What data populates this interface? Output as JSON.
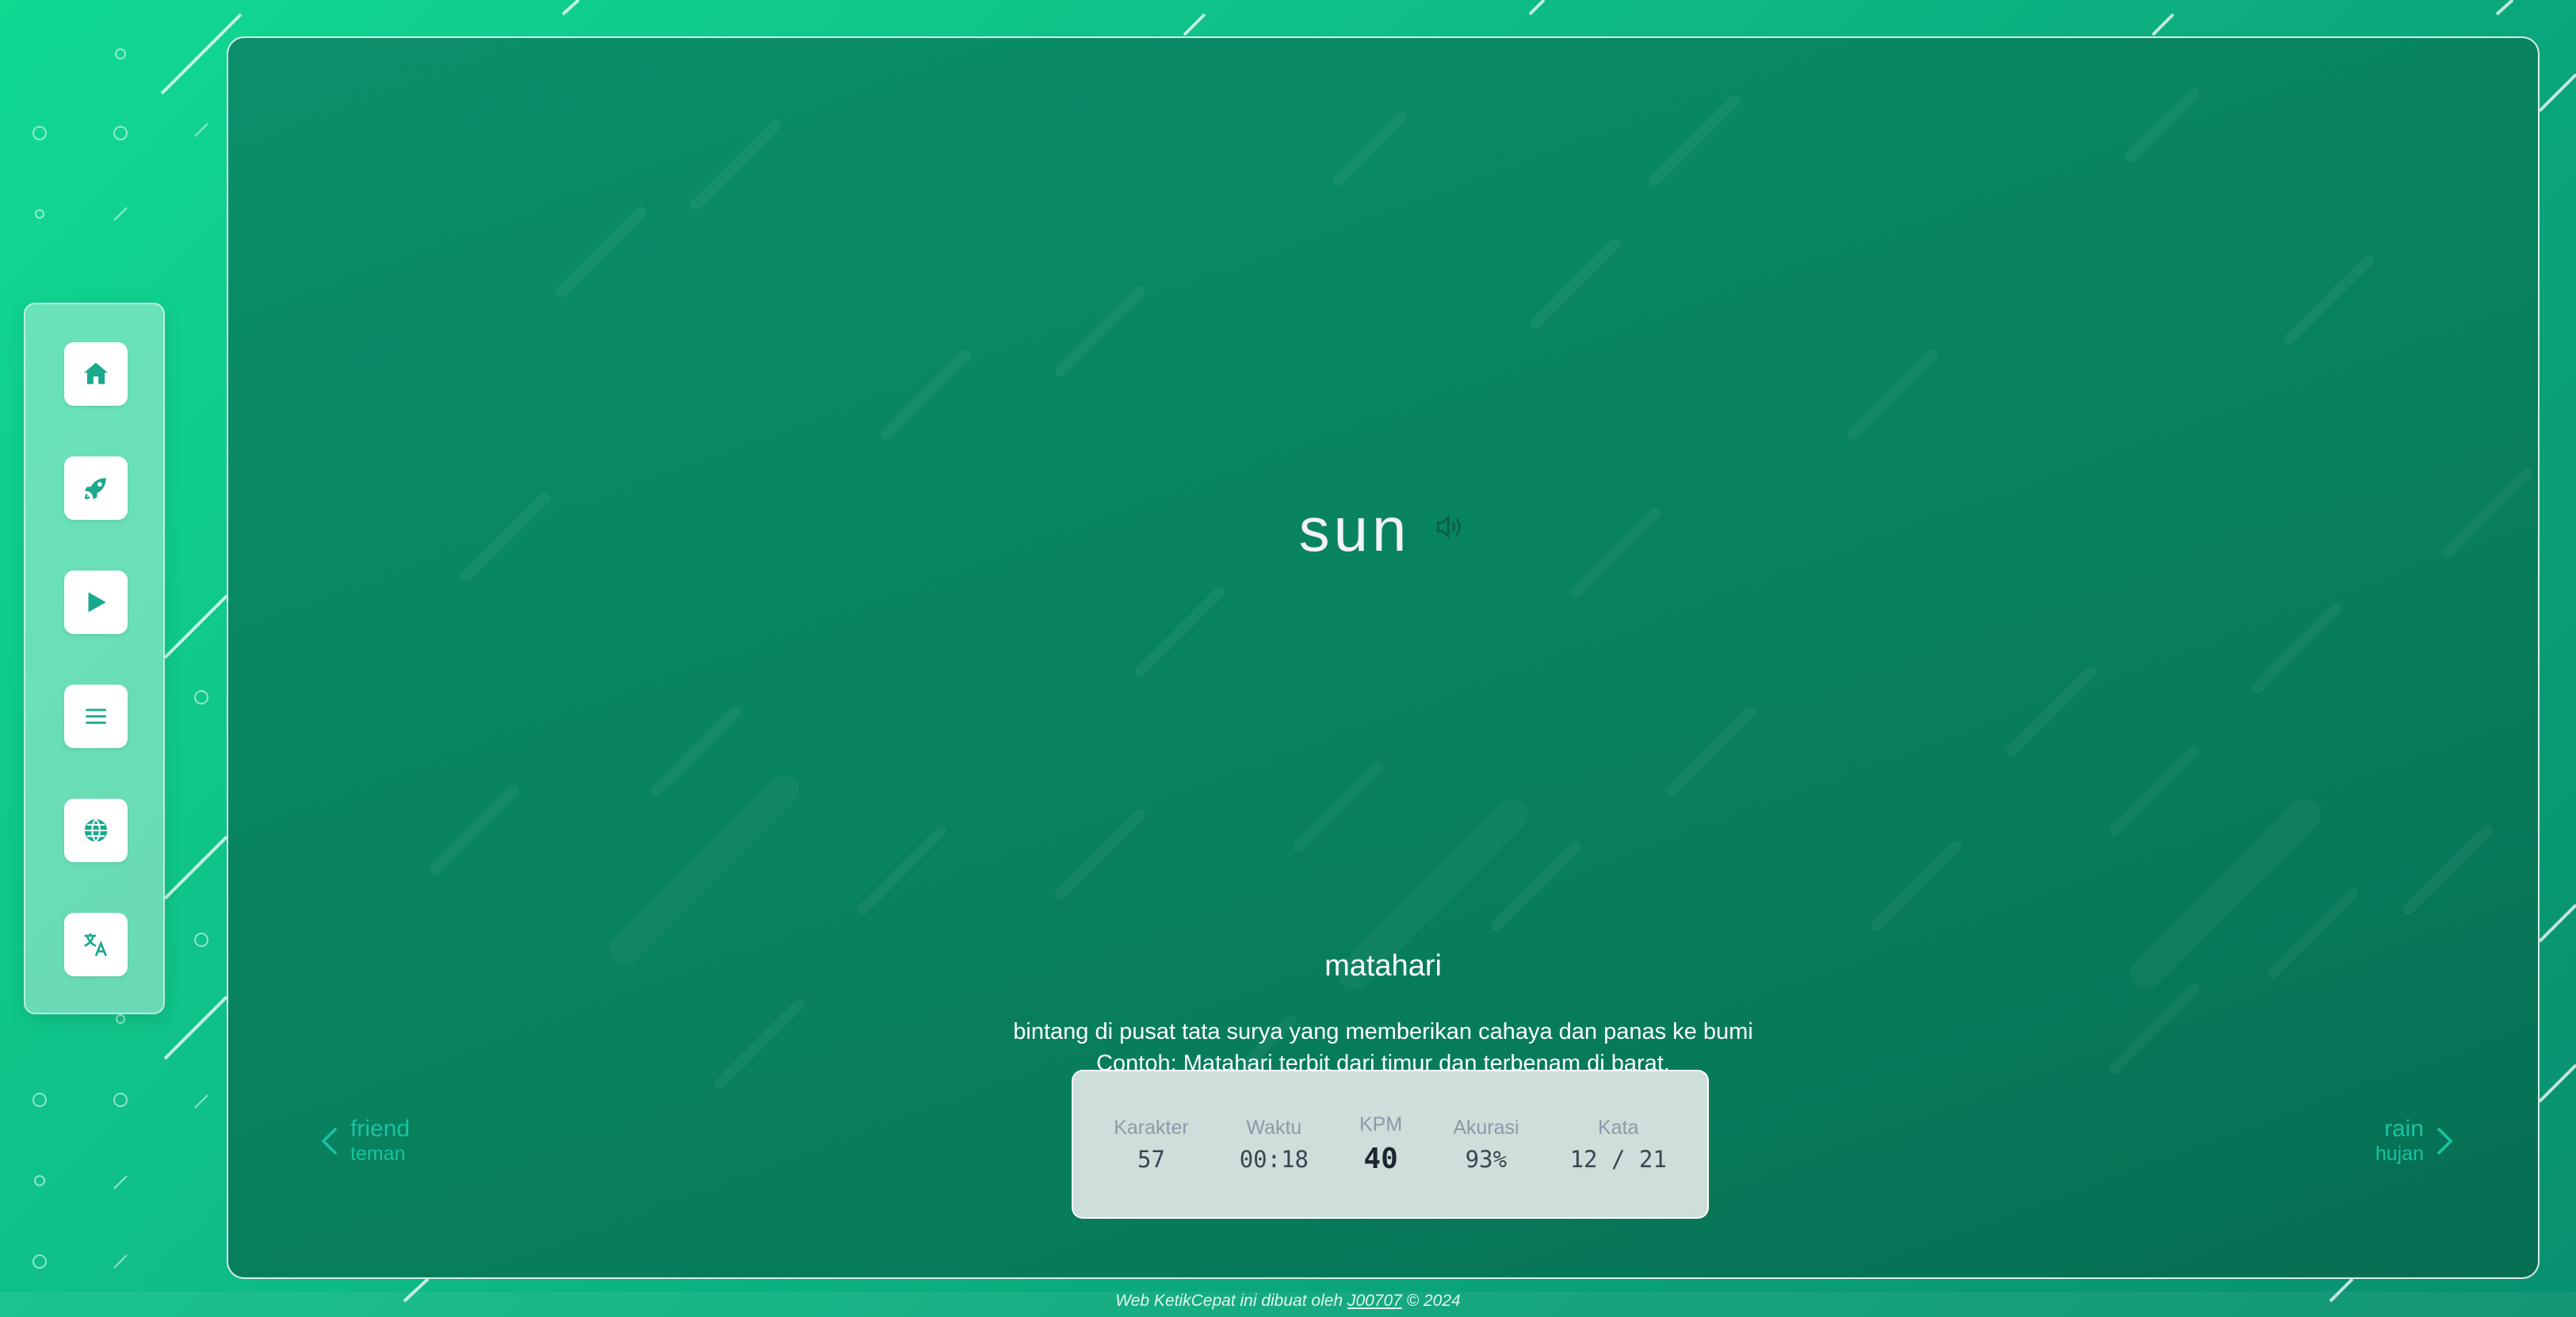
{
  "sidebar": {
    "items": [
      {
        "icon": "home-icon"
      },
      {
        "icon": "rocket-icon"
      },
      {
        "icon": "play-icon"
      },
      {
        "icon": "menu-icon"
      },
      {
        "icon": "globe-icon"
      },
      {
        "icon": "translate-icon"
      }
    ]
  },
  "word": {
    "text": "sun",
    "audio_icon": "speaker-icon"
  },
  "meaning": {
    "translation": "matahari",
    "definition": "bintang di pusat tata surya yang memberikan cahaya dan panas ke bumi",
    "example": "Contoh: Matahari terbit dari timur dan terbenam di barat."
  },
  "stats": {
    "characters": {
      "label": "Karakter",
      "value": "57"
    },
    "time": {
      "label": "Waktu",
      "value": "00:18"
    },
    "kpm": {
      "label": "KPM",
      "value": "40"
    },
    "accuracy": {
      "label": "Akurasi",
      "value": "93%"
    },
    "words": {
      "label": "Kata",
      "value": "12 / 21"
    }
  },
  "nav": {
    "prev": {
      "word": "friend",
      "translation": "teman"
    },
    "next": {
      "word": "rain",
      "translation": "hujan"
    }
  },
  "footer": {
    "prefix": "Web KetikCepat ini dibuat oleh ",
    "author": "J00707",
    "suffix": " © 2024"
  },
  "colors": {
    "accent": "#1aa98c",
    "nav_text": "#19c3a2",
    "panel_bg": "#08835f"
  }
}
